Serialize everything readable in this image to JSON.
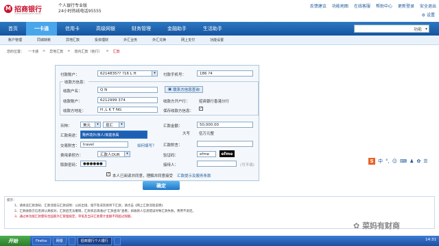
{
  "header": {
    "bank_name": "招商银行",
    "bank_name_en": "CHINA MERCHANTS BANK",
    "service_name": "个人银行专业版",
    "hotline": "24小时热线电话95555",
    "top_links": [
      "反馈建议",
      "功能地图",
      "在线客服",
      "帮助中心",
      "更新登录",
      "安全退出"
    ],
    "settings_label": "设置"
  },
  "nav": {
    "items": [
      "首页",
      "一卡通",
      "信用卡",
      "高级网银",
      "财务管理",
      "金融助手",
      "生活助手"
    ],
    "active_index": 1,
    "search_label": "功能"
  },
  "subnav": {
    "items": [
      "账户管理",
      "同城转账",
      "异地汇款",
      "投资理财",
      "外汇业务",
      "外汇兑换",
      "网上支付",
      "功能设置"
    ]
  },
  "breadcrumb": {
    "prefix": "您的位置：",
    "items": [
      "一卡通",
      "异地汇款",
      "境内汇款（他行）",
      "汇款"
    ],
    "active": "汇款"
  },
  "form": {
    "pay_account_label": "付款账户：",
    "pay_account_value": "6214835??   ?16  L H",
    "pay_phone_label": "付款手机号：",
    "pay_phone_value": "186   ?4",
    "payee_section_title": "收款方信息：",
    "payee_name_label": "收款户名：",
    "payee_name_value": "Q  N",
    "lookup_button": "联系方信息查询",
    "payee_account_label": "收款账户：",
    "payee_account_value": "6212999    374",
    "payee_bank_label": "收款方开户行：",
    "payee_bank_value": "招商银行香港分行",
    "payee_address_label": "收款方地址：",
    "payee_address_value": "H  ,L  K  T  NG",
    "save_payee_label": "保存收款方信息：",
    "currency_label": "币种：",
    "currency_value": "美元",
    "cash_type_value": "现汇",
    "amount_label": "汇款金额：",
    "amount_value": "50,000.00",
    "amount_uppercase_label": "大写",
    "amount_uppercase_value": "伍万元整",
    "purpose_label": "汇款用途：",
    "purpose_option": "赡养境外/亲人/家庭亲属",
    "attachment_label": "汇款附言：",
    "method_label": "交易附言：",
    "method_value": "travel",
    "help_link": "如何填写？",
    "fee_label": "费用承担方：",
    "fee_value": "汇款人OUR",
    "code_label": "验证码：",
    "code_value": "efme",
    "captcha_text": "efme",
    "password_label": "取款密码：",
    "password_value": "●●●●●●",
    "agent_label": "接待人：",
    "agent_hint": "(可不填)"
  },
  "confirm": {
    "checkbox_label": "本人已阅读并同意，理解并同意接受",
    "terms_link": "汇款提示及服务条款",
    "button_label": "确定"
  },
  "notes": {
    "title": "提示：",
    "lines": [
      "1、请阅读汇款须知、汇款流程与汇款说明：公民出境、留学及非贸易项下汇款，请点击《网上汇款流程说明》",
      "2、汇款收款方信息请认真核对，汇款后无法撤销，汇款状态请通过“汇款查询”查看；如收款人信息错误导致汇款失败，费用不退还。",
      "3、通过本功能汇款需符合国家外汇管理规定，单笔及当日汇款累计金额不得超过限额。"
    ]
  },
  "ime": {
    "label": "中"
  },
  "watermark": "菜妈有财商",
  "taskbar": {
    "start_label": "开始",
    "tasks": [
      "Firefox",
      "网银",
      "",
      "招商银行个人银行",
      ""
    ],
    "active_task": 3,
    "clock": "14:31"
  }
}
